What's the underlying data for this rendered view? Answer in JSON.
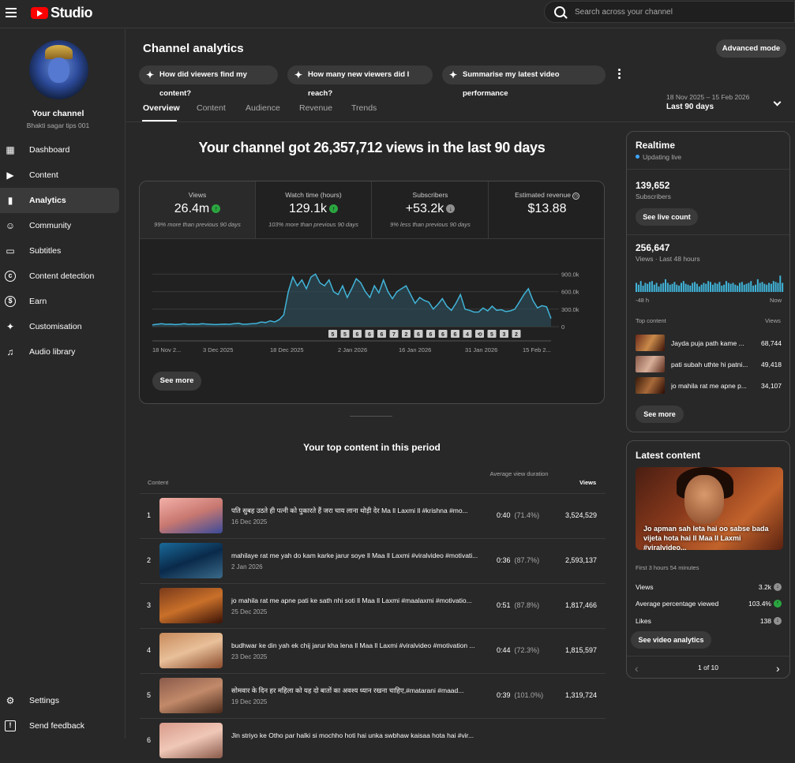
{
  "app": {
    "name": "Studio"
  },
  "search": {
    "placeholder": "Search across your channel"
  },
  "sidebar": {
    "channel_name": "Your channel",
    "channel_handle": "Bhakti sagar tips 001",
    "items": [
      {
        "label": "Dashboard",
        "icon": "dashboard-icon"
      },
      {
        "label": "Content",
        "icon": "content-icon"
      },
      {
        "label": "Analytics",
        "icon": "analytics-icon",
        "active": true
      },
      {
        "label": "Community",
        "icon": "community-icon"
      },
      {
        "label": "Subtitles",
        "icon": "subtitles-icon"
      },
      {
        "label": "Content detection",
        "icon": "copyright-icon"
      },
      {
        "label": "Earn",
        "icon": "dollar-icon"
      },
      {
        "label": "Customisation",
        "icon": "magic-wand-icon"
      },
      {
        "label": "Audio library",
        "icon": "audio-library-icon"
      }
    ],
    "bottom": [
      {
        "label": "Settings",
        "icon": "gear-icon"
      },
      {
        "label": "Send feedback",
        "icon": "feedback-icon"
      }
    ]
  },
  "header": {
    "title": "Channel analytics",
    "advanced_mode": "Advanced mode",
    "chips": [
      "How did viewers find my content?",
      "How many new viewers did I reach?",
      "Summarise my latest video performance"
    ],
    "tabs": [
      "Overview",
      "Content",
      "Audience",
      "Revenue",
      "Trends"
    ],
    "date_range": "18 Nov 2025 – 15 Feb 2026",
    "date_label": "Last 90 days"
  },
  "overview": {
    "headline": "Your channel got 26,357,712 views in the last 90 days",
    "stats": [
      {
        "title": "Views",
        "value": "26.4m",
        "trend": "up",
        "note": "99% more than previous 90 days"
      },
      {
        "title": "Watch time (hours)",
        "value": "129.1k",
        "trend": "up",
        "note": "103% more than previous 90 days"
      },
      {
        "title": "Subscribers",
        "value": "+53.2k",
        "trend": "down",
        "note": "9% less than previous 90 days"
      },
      {
        "title": "Estimated revenue",
        "value": "$13.88",
        "trend": "info",
        "note": ""
      }
    ],
    "see_more": "See more"
  },
  "chart_data": {
    "type": "area",
    "x_ticks": [
      "18 Nov 2...",
      "3 Dec 2025",
      "18 Dec 2025",
      "2 Jan 2026",
      "16 Jan 2026",
      "31 Jan 2026",
      "15 Feb 2..."
    ],
    "y_ticks": [
      "0",
      "300.0k",
      "600.0k",
      "900.0k"
    ],
    "ylim": [
      0,
      1000000
    ],
    "series": [
      {
        "values": [
          30000,
          40000,
          50000,
          40000,
          45000,
          35000,
          40000,
          50000,
          40000,
          45000,
          40000,
          50000,
          45000,
          40000,
          35000,
          40000,
          45000,
          40000,
          50000,
          60000,
          40000,
          45000,
          50000,
          55000,
          80000,
          70000,
          100000,
          80000,
          120000,
          200000,
          600000,
          850000,
          700000,
          800000,
          650000,
          850000,
          900000,
          750000,
          700000,
          800000,
          600000,
          550000,
          700000,
          500000,
          650000,
          820000,
          750000,
          600000,
          500000,
          700000,
          580000,
          800000,
          600000,
          480000,
          600000,
          650000,
          700000,
          550000,
          400000,
          500000,
          450000,
          420000,
          300000,
          380000,
          480000,
          350000,
          280000,
          400000,
          550000,
          300000,
          280000,
          250000,
          250000,
          320000,
          270000,
          350000,
          280000,
          290000,
          260000,
          270000,
          300000,
          420000,
          550000,
          650000,
          450000,
          320000,
          360000,
          340000,
          140000
        ]
      }
    ],
    "markers": [
      "5",
      "5",
      "6",
      "6",
      "6",
      "7",
      "2",
      "6",
      "6",
      "6",
      "6",
      "4",
      "",
      "5",
      "3",
      "2"
    ],
    "grid": true
  },
  "top_content": {
    "title": "Your top content in this period",
    "col_content": "Content",
    "col_avd": "Average view duration",
    "col_views": "Views",
    "rows": [
      {
        "n": "1",
        "title": "पति सुबह उठते ही पत्नी को पुकारते हैं जरा चाय लाना थोड़ी देर Ma ll Laxmi ll #krishna #mo...",
        "date": "16 Dec 2025",
        "avd": "0:40",
        "pct": "(71.4%)",
        "views": "3,524,529"
      },
      {
        "n": "2",
        "title": "mahilaye rat me yah do kam karke jarur soye ll Maa ll Laxmi #viralvideo #motivati...",
        "date": "2 Jan 2026",
        "avd": "0:36",
        "pct": "(87.7%)",
        "views": "2,593,137"
      },
      {
        "n": "3",
        "title": "jo mahila rat me apne pati ke sath nhi soti ll Maa ll Laxmi #maalaxmi #motivatio...",
        "date": "25 Dec 2025",
        "avd": "0:51",
        "pct": "(87.8%)",
        "views": "1,817,466"
      },
      {
        "n": "4",
        "title": "budhwar ke din yah ek chij jarur kha lena ll Maa ll Laxmi #viralvideo #motivation ...",
        "date": "23 Dec 2025",
        "avd": "0:44",
        "pct": "(72.3%)",
        "views": "1,815,597"
      },
      {
        "n": "5",
        "title": "सोमवार के दिन हर महिला को यह दो बातों का अवश्य ध्यान रखना चाहिए,#matarani #maad...",
        "date": "19 Dec 2025",
        "avd": "0:39",
        "pct": "(101.0%)",
        "views": "1,319,724"
      },
      {
        "n": "6",
        "title": "Jin striyo ke Otho par halki si mochho hoti hai unka swbhaw kaisaa hota hai #vir...",
        "date": "",
        "avd": "",
        "pct": "",
        "views": ""
      }
    ]
  },
  "realtime": {
    "title": "Realtime",
    "status": "Updating live",
    "subs_value": "139,652",
    "subs_label": "Subscribers",
    "live_count": "See live count",
    "views_value": "256,647",
    "views_label": "Views · Last 48 hours",
    "axis_left": "-48 h",
    "axis_right": "Now",
    "bars": [
      0.5,
      0.4,
      0.6,
      0.35,
      0.5,
      0.45,
      0.55,
      0.6,
      0.4,
      0.5,
      0.3,
      0.45,
      0.5,
      0.7,
      0.5,
      0.4,
      0.45,
      0.55,
      0.4,
      0.35,
      0.5,
      0.6,
      0.45,
      0.4,
      0.35,
      0.5,
      0.55,
      0.45,
      0.3,
      0.4,
      0.5,
      0.45,
      0.6,
      0.55,
      0.4,
      0.5,
      0.45,
      0.55,
      0.35,
      0.4,
      0.6,
      0.5,
      0.45,
      0.5,
      0.4,
      0.35,
      0.5,
      0.55,
      0.4,
      0.45,
      0.5,
      0.6,
      0.35,
      0.4,
      0.7,
      0.5,
      0.55,
      0.45,
      0.4,
      0.5,
      0.45,
      0.6,
      0.55,
      0.5,
      0.9,
      0.5
    ],
    "top_content_label": "Top content",
    "views_col": "Views",
    "top": [
      {
        "title": "Jayda puja path kame ...",
        "views": "68,744"
      },
      {
        "title": "pati subah uthte hi patni...",
        "views": "49,418"
      },
      {
        "title": "jo mahila rat me apne p...",
        "views": "34,107"
      }
    ],
    "see_more": "See more"
  },
  "latest": {
    "title": "Latest content",
    "caption": "Jo apman sah leta hai oo sabse bada vijeta hota hai ll Maa ll Laxmi #viralvideo...",
    "period": "First 3 hours 54 minutes",
    "metrics": [
      {
        "label": "Views",
        "value": "3.2k",
        "trend": "down"
      },
      {
        "label": "Average percentage viewed",
        "value": "103.4%",
        "trend": "up"
      },
      {
        "label": "Likes",
        "value": "138",
        "trend": "down"
      }
    ],
    "see_analytics": "See video analytics",
    "pager": "1 of 10"
  }
}
